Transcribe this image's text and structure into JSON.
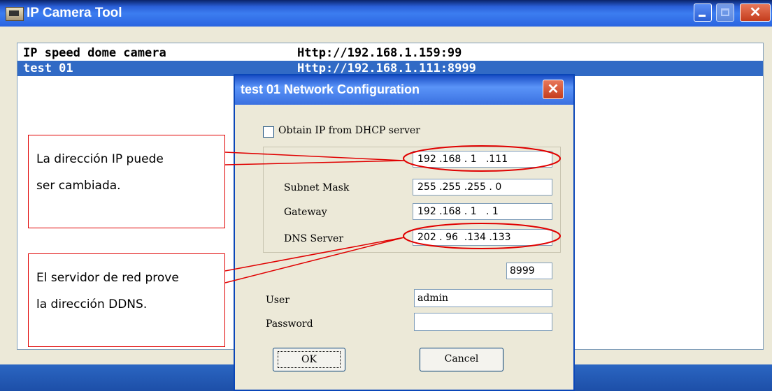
{
  "window": {
    "title": "IP Camera Tool",
    "close_glyph": "✕"
  },
  "camera_list": [
    {
      "name": "IP speed dome camera",
      "url": "Http://192.168.1.159:99",
      "selected": false
    },
    {
      "name": "test 01",
      "url": "Http://192.168.1.111:8999",
      "selected": true
    }
  ],
  "dialog": {
    "title": "test 01 Network Configuration",
    "close_glyph": "✕",
    "dhcp_label": "Obtain IP from DHCP server",
    "dhcp_checked": false,
    "ip_address": "192 .168 . 1   .111",
    "subnet_label": "Subnet Mask",
    "subnet_mask": "255 .255 .255 . 0",
    "gateway_label": "Gateway",
    "gateway": "192 .168 . 1   . 1",
    "dns_label": "DNS Server",
    "dns_server": "202 . 96  .134 .133",
    "port": "8999",
    "user_label": "User",
    "user": "admin",
    "password_label": "Password",
    "password": "",
    "ok_label": "OK",
    "cancel_label": "Cancel"
  },
  "callouts": {
    "ip_line1": "La dirección IP puede",
    "ip_line2": "ser cambiada.",
    "dns_line1": "El servidor de red prove",
    "dns_line2": "la dirección DDNS."
  },
  "colors": {
    "titlebar": "#2a64e0",
    "selection": "#316ac5",
    "annotation": "#e00000",
    "dialog_bg": "#ece9d8"
  }
}
